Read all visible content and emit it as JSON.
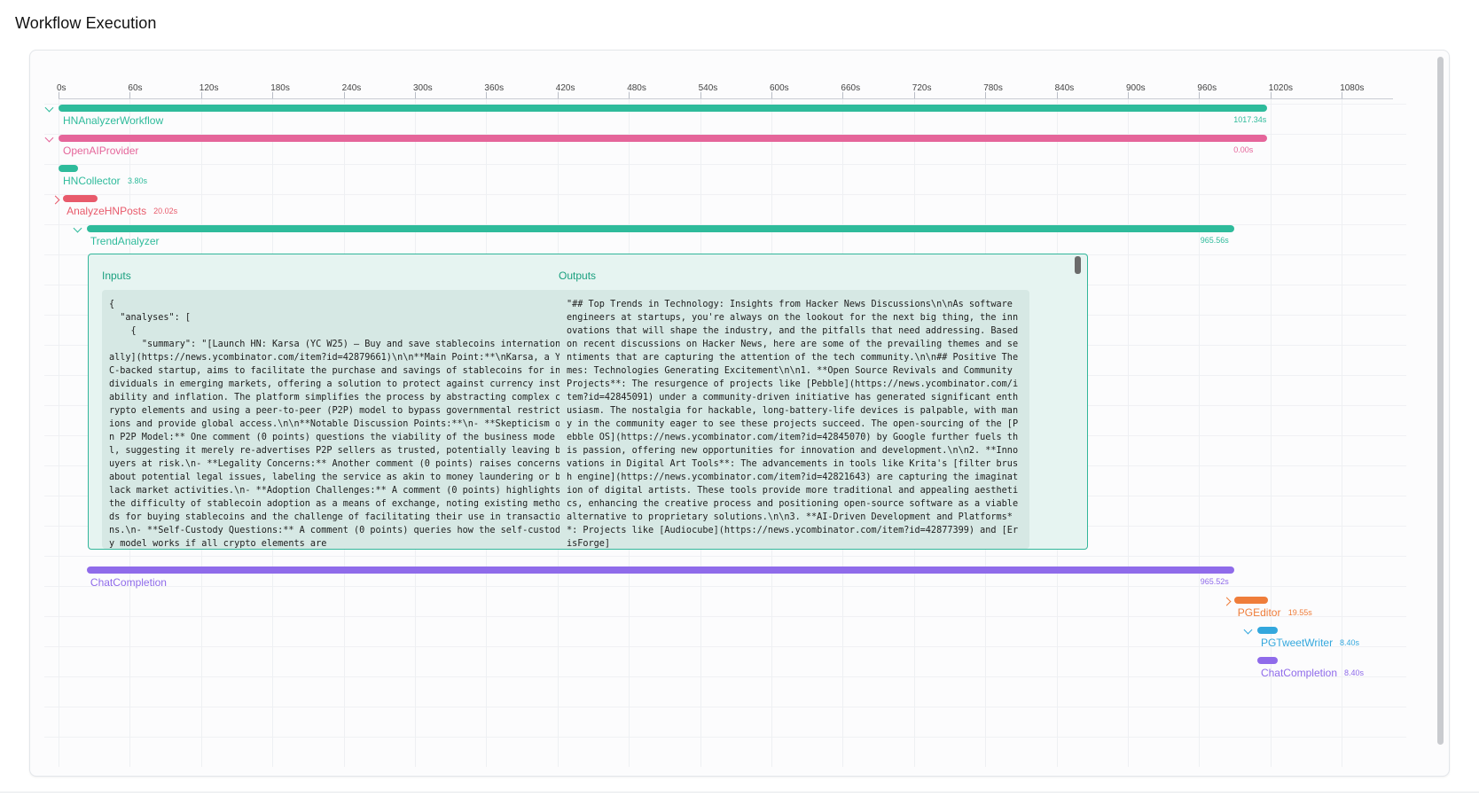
{
  "page": {
    "title": "Workflow Execution"
  },
  "colors": {
    "teal": "#2ebb9b",
    "pink": "#e5659a",
    "red": "#e85a6b",
    "purple": "#8f6bea",
    "orange": "#ef7d3a",
    "blue": "#33a7dd"
  },
  "timeline": {
    "ticks": [
      "0s",
      "60s",
      "120s",
      "180s",
      "240s",
      "300s",
      "360s",
      "420s",
      "480s",
      "540s",
      "600s",
      "660s",
      "720s",
      "780s",
      "840s",
      "900s",
      "960s",
      "1020s",
      "1080s"
    ],
    "rows": [
      {
        "name": "HNAnalyzerWorkflow",
        "duration": "1017.34s",
        "color": "#2ebb9b",
        "expander": "expanded",
        "start_s": 0,
        "end_s": 1017.34,
        "dur_pos": "end"
      },
      {
        "name": "OpenAIProvider",
        "duration": "0.00s",
        "color": "#e5659a",
        "expander": "expanded",
        "start_s": 0,
        "end_s": 1017.34,
        "dur_pos": "end"
      },
      {
        "name": "HNCollector",
        "duration": "3.80s",
        "color": "#2ebb9b",
        "expander": "none",
        "start_s": 0,
        "end_s": 3.8,
        "dur_pos": "inline"
      },
      {
        "name": "AnalyzeHNPosts",
        "duration": "20.02s",
        "color": "#e85a6b",
        "expander": "collapsed",
        "start_s": 3.8,
        "end_s": 23.82,
        "dur_pos": "inline"
      },
      {
        "name": "TrendAnalyzer",
        "duration": "965.56s",
        "color": "#2ebb9b",
        "expander": "expanded",
        "start_s": 23.82,
        "end_s": 989.38,
        "dur_pos": "end"
      },
      {
        "name": "ChatCompletion",
        "duration": "965.52s",
        "color": "#8f6bea",
        "expander": "none",
        "start_s": 23.82,
        "end_s": 989.34,
        "dur_pos": "end"
      },
      {
        "name": "PGEditor",
        "duration": "19.55s",
        "color": "#ef7d3a",
        "expander": "collapsed",
        "start_s": 989.38,
        "end_s": 1008.93,
        "dur_pos": "inline"
      },
      {
        "name": "PGTweetWriter",
        "duration": "8.40s",
        "color": "#33a7dd",
        "expander": "expanded",
        "start_s": 1008.93,
        "end_s": 1017.33,
        "dur_pos": "inline"
      },
      {
        "name": "ChatCompletion",
        "duration": "8.40s",
        "color": "#8f6bea",
        "expander": "none",
        "start_s": 1008.93,
        "end_s": 1017.33,
        "dur_pos": "inline"
      }
    ]
  },
  "detail": {
    "inputs_label": "Inputs",
    "outputs_label": "Outputs",
    "inputs_text": "{\n  \"analyses\": [\n    {\n      \"summary\": \"[Launch HN: Karsa (YC W25) – Buy and save stablecoins internationally](https://news.ycombinator.com/item?id=42879661)\\n\\n**Main Point:**\\nKarsa, a YC-backed startup, aims to facilitate the purchase and savings of stablecoins for individuals in emerging markets, offering a solution to protect against currency instability and inflation. The platform simplifies the process by abstracting complex crypto elements and using a peer-to-peer (P2P) model to bypass governmental restrictions and provide global access.\\n\\n**Notable Discussion Points:**\\n- **Skepticism on P2P Model:** One comment (0 points) questions the viability of the business model, suggesting it merely re-advertises P2P sellers as trusted, potentially leaving buyers at risk.\\n- **Legality Concerns:** Another comment (0 points) raises concerns about potential legal issues, labeling the service as akin to money laundering or black market activities.\\n- **Adoption Challenges:** A comment (0 points) highlights the difficulty of stablecoin adoption as a means of exchange, noting existing methods for buying stablecoins and the challenge of facilitating their use in transactions.\\n- **Self-Custody Questions:** A comment (0 points) queries how the self-custody model works if all crypto elements are",
    "outputs_text": "\"## Top Trends in Technology: Insights from Hacker News Discussions\\n\\nAs software engineers at startups, you're always on the lookout for the next big thing, the innovations that will shape the industry, and the pitfalls that need addressing. Based on recent discussions on Hacker News, here are some of the prevailing themes and sentiments that are capturing the attention of the tech community.\\n\\n## Positive Themes: Technologies Generating Excitement\\n\\n1. **Open Source Revivals and Community Projects**: The resurgence of projects like [Pebble](https://news.ycombinator.com/item?id=42845091) under a community-driven initiative has generated significant enthusiasm. The nostalgia for hackable, long-battery-life devices is palpable, with many in the community eager to see these projects succeed. The open-sourcing of the [Pebble OS](https://news.ycombinator.com/item?id=42845070) by Google further fuels this passion, offering new opportunities for innovation and development.\\n\\n2. **Innovations in Digital Art Tools**: The advancements in tools like Krita's [filter brush engine](https://news.ycombinator.com/item?id=42821643) are capturing the imagination of digital artists. These tools provide more traditional and appealing aesthetics, enhancing the creative process and positioning open-source software as a viable alternative to proprietary solutions.\\n\\n3. **AI-Driven Development and Platforms**: Projects like [Audiocube](https://news.ycombinator.com/item?id=42877399) and [ErisForge]"
  }
}
